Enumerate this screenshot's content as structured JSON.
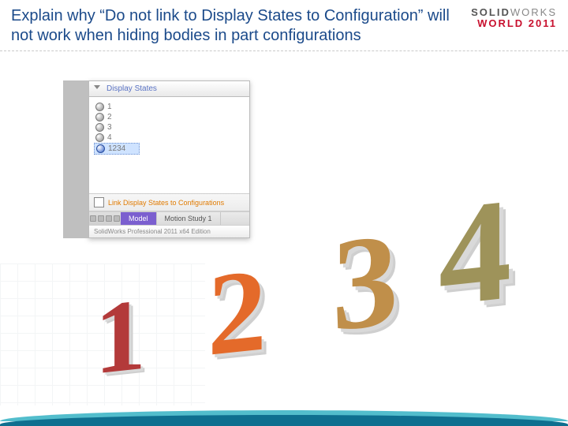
{
  "title": "Explain why “Do not link to Display States to Configuration” will not work when hiding bodies in part configurations",
  "brand": {
    "line1a": "SOLID",
    "line1b": "WORKS",
    "line2": "WORLD 2011"
  },
  "panel": {
    "header": "Display States",
    "items": [
      "1",
      "2",
      "3",
      "4"
    ],
    "selected": "1234",
    "checkbox_label": "Link Display States to Configurations",
    "tabs": {
      "model": "Model",
      "motion": "Motion Study 1"
    },
    "status": "SolidWorks Professional 2011 x64 Edition"
  },
  "numbers": {
    "n1": "1",
    "n2": "2",
    "n3": "3",
    "n4": "4"
  }
}
